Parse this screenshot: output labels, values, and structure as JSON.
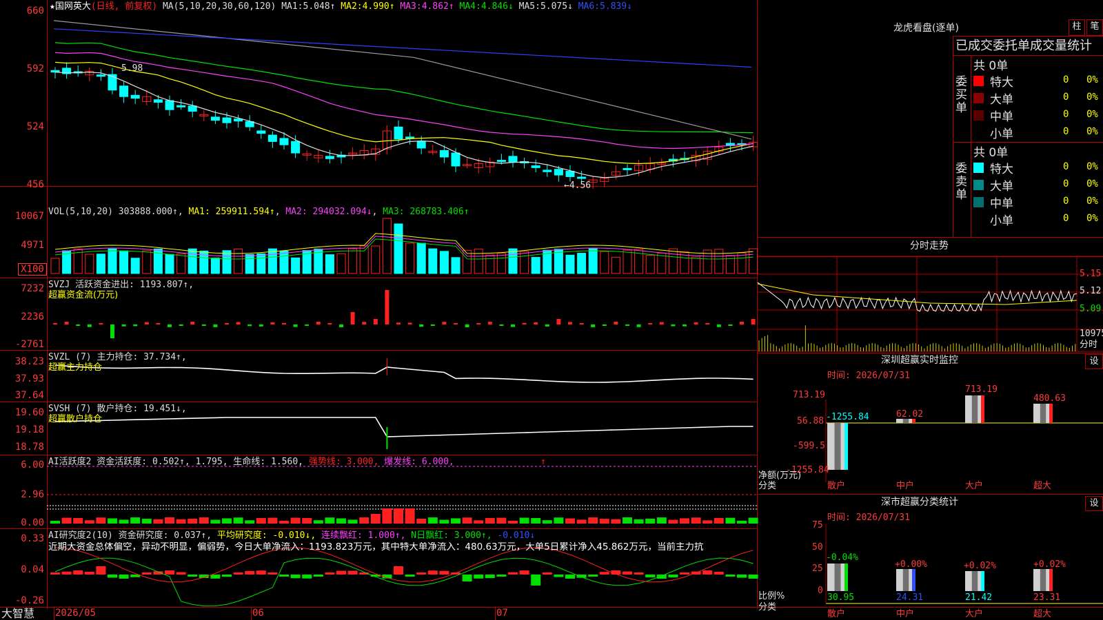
{
  "main_header": {
    "star": "★",
    "stock_name": "国网英大",
    "mode": "(日线, 前复权)",
    "ma_label": "MA(5,10,20,30,60,120)",
    "ma1_label": "MA1:",
    "ma1": "5.048↑",
    "ma2_label": "MA2:",
    "ma2": "4.990↑",
    "ma3_label": "MA3:",
    "ma3": "4.862↑",
    "ma4_label": "MA4:",
    "ma4": "4.846↓",
    "ma5_label": "MA5:",
    "ma5": "5.075↓",
    "ma6_label": "MA6:",
    "ma6": "5.839↓",
    "high_marker": "5.98",
    "low_marker": "←4.56"
  },
  "y_axis": {
    "main": [
      "660",
      "592",
      "524",
      "456"
    ],
    "vol": [
      "10067",
      "4971",
      "X100"
    ],
    "svzj": [
      "7232",
      "2236",
      "-2761"
    ],
    "svzl": [
      "38.23",
      "37.93",
      "37.64"
    ],
    "svsh": [
      "19.60",
      "19.18",
      "18.78"
    ],
    "ai1": [
      "6.00",
      "2.96",
      "0.00"
    ],
    "ai2": [
      "0.33",
      "0.04",
      "-0.26"
    ]
  },
  "vol_header": {
    "label": "VOL(5,10,20)",
    "value": "303888.000↑",
    "ma1": "MA1: 259911.594↑",
    "ma2": "MA2: 294032.094↓",
    "ma3": "MA3: 268783.406↑"
  },
  "svzj_header": {
    "label": "SVZJ  活跃资金进出: 1193.807↑,",
    "sub": "超赢资金流(万元)"
  },
  "svzl_header": {
    "label": "SVZL (7) 主力持仓: 37.734↑,",
    "sub": "超赢主力持仓"
  },
  "svsh_header": {
    "label": "SVSH (7) 散户持仓: 19.451↓,",
    "sub": "超赢散户持仓"
  },
  "ai1_header": {
    "label": "AI活跃度2 资金活跃度: 0.502↑, 1.795, 生命线: 1.560,",
    "strong": "强势线: 3.000,",
    "burst": "爆发线: 6.000,",
    "arrow": "↑"
  },
  "ai2_header": {
    "label": "AI研究度2(10) 资金研究度: 0.037↑,",
    "avg": "平均研究度: -0.010↓,",
    "lianxu": "连续飘红: 1.000↑,",
    "nday": "N日飘红: 3.000↑,",
    "tail": "-0.010↓",
    "commentary": "近期大资金总体偏空，异动不明显，偏弱势，今日大单净流入：1193.823万元，其中特大单净流入：480.63万元，大单5日累计净入45.862万元，当前主力抗"
  },
  "x_axis": {
    "d1": "2026/05",
    "d2": "06",
    "d3": "07"
  },
  "brand": "大智慧",
  "right_panel": {
    "lhb_title": "龙虎看盘(逐单)",
    "btn_zhu": "柱",
    "btn_bi": "笔",
    "stat_title": "已成交委托单成交量统计",
    "buy_side": "委买单",
    "sell_side": "委卖单",
    "buy_total": "共 0单",
    "sell_total": "共 0单",
    "buy_rows": [
      {
        "label": "特大",
        "count": "0",
        "pct": "0%"
      },
      {
        "label": "大单",
        "count": "0",
        "pct": "0%"
      },
      {
        "label": "中单",
        "count": "0",
        "pct": "0%"
      },
      {
        "label": "小单",
        "count": "0",
        "pct": "0%"
      }
    ],
    "sell_rows": [
      {
        "label": "特大",
        "count": "0",
        "pct": "0%"
      },
      {
        "label": "大单",
        "count": "0",
        "pct": "0%"
      },
      {
        "label": "中单",
        "count": "0",
        "pct": "0%"
      },
      {
        "label": "小单",
        "count": "0",
        "pct": "0%"
      }
    ],
    "intraday_title": "分时走势",
    "intraday_prices": [
      "5.15",
      "5.12",
      "5.09"
    ],
    "intraday_vol": "10975",
    "intraday_tab": "分时",
    "sz_monitor_title": "深圳超赢实时监控",
    "set1": "设",
    "time1": "时间: 2026/07/31",
    "mon_y": [
      "713.19",
      "56.88",
      "-599.5",
      "-1255.84"
    ],
    "mon_bars": [
      "-1255.84",
      "62.02",
      "713.19",
      "480.63"
    ],
    "mon_ylabel": "净额(万元)",
    "mon_xlabel": "分类",
    "categories": [
      "散户",
      "中户",
      "大户",
      "超大"
    ],
    "sz_class_title": "深市超赢分类统计",
    "set2": "设",
    "time2": "时间: 2026/07/31",
    "cls_y": [
      "75",
      "50",
      "25",
      "0"
    ],
    "cls_top": [
      "-0.04%",
      "+0.00%",
      "+0.02%",
      "+0.02%"
    ],
    "cls_vals": [
      "30.95",
      "24.31",
      "21.42",
      "23.31"
    ],
    "cls_ylabel": "比例%",
    "cls_xlabel": "分类"
  },
  "colors": {
    "up": "#ff2020",
    "down": "#00ffff",
    "grid": "#b00000",
    "gain": "#00e000"
  }
}
